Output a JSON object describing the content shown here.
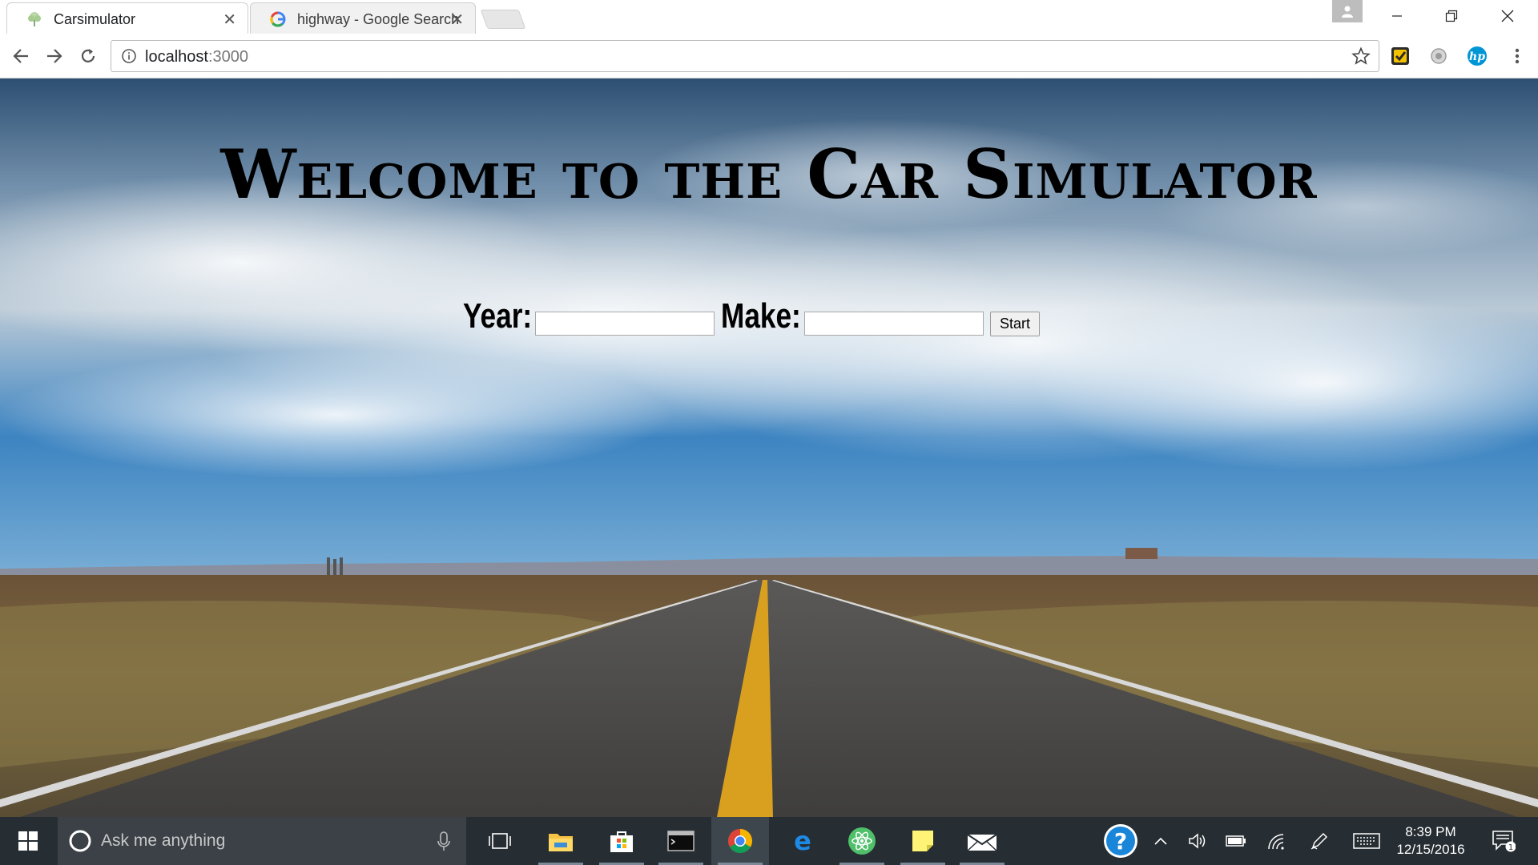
{
  "browser": {
    "tabs": [
      {
        "title": "Carsimulator",
        "active": true,
        "icon": "tree-favicon-icon"
      },
      {
        "title": "highway - Google Search",
        "active": false,
        "icon": "google-g-icon"
      }
    ],
    "url_host": "localhost",
    "url_port": ":3000"
  },
  "page": {
    "headline": "Welcome to the Car Simulator",
    "year_label": "Year:",
    "make_label": "Make:",
    "year_value": "",
    "make_value": "",
    "start_label": "Start"
  },
  "taskbar": {
    "search_placeholder": "Ask me anything",
    "time": "8:39 PM",
    "date": "12/15/2016",
    "notification_count": "1",
    "apps": [
      "file-explorer-icon",
      "store-icon",
      "terminal-icon",
      "chrome-icon",
      "edge-icon",
      "atom-icon",
      "sticky-notes-icon",
      "mail-icon"
    ]
  },
  "colors": {
    "sky_top": "#2f5d8a",
    "sky_mid": "#8fb6d8",
    "ground": "#6b5a3a",
    "road": "#4a4a48",
    "center_line": "#e2a81a",
    "taskbar": "#262d33"
  }
}
